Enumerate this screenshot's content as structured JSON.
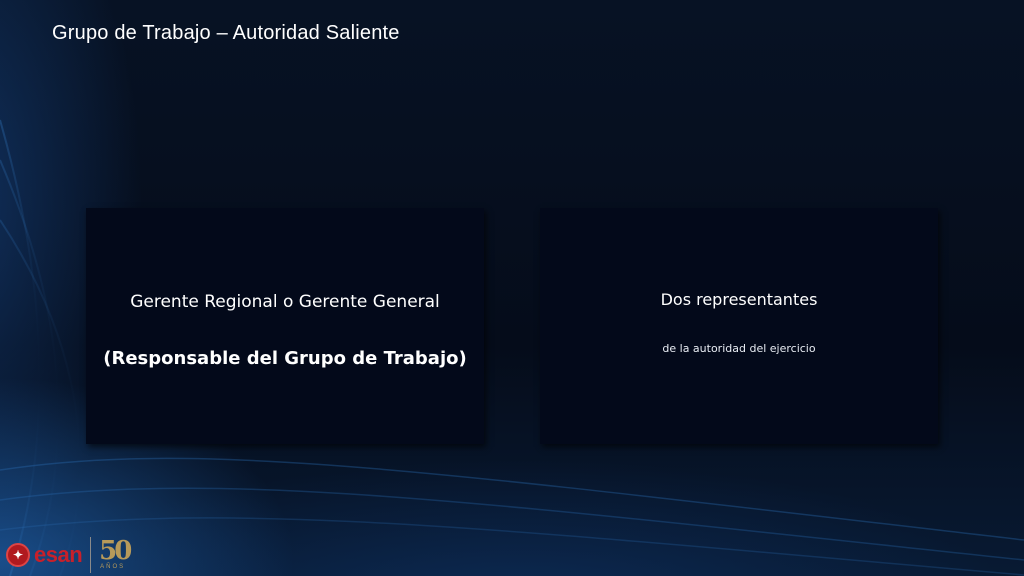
{
  "slide": {
    "title": "Grupo de Trabajo – Autoridad Saliente"
  },
  "left_card": {
    "line1": "Gerente Regional o Gerente General",
    "line2": "(Responsable del Grupo de Trabajo)"
  },
  "right_card": {
    "line1": "Dos representantes",
    "line2": "de la autoridad del ejercicio"
  },
  "footer": {
    "brand": "esan",
    "anniversary_number": "50",
    "anniversary_label": "AÑOS",
    "brand_color": "#c8202a",
    "gold_color": "#b79a5a"
  }
}
